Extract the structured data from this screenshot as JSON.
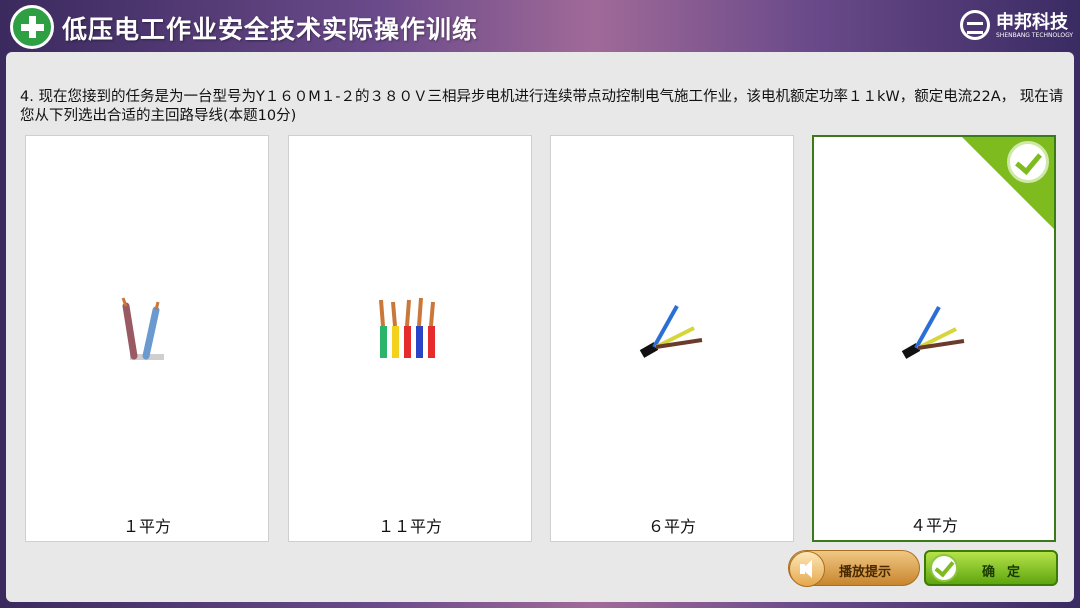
{
  "header": {
    "title": "低压电工作业安全技术实际操作训练",
    "brand_name": "申邦科技",
    "brand_sub": "SHENBANG TECHNOLOGY"
  },
  "question": {
    "text": "4. 现在您接到的任务是为一台型号为Y１６０M１-２的３８０Ｖ三相异步电机进行连续带点动控制电气施工作业，该电机额定功率１１kW，额定电流22A， 现在请您从下列选出合适的主回路导线(本题10分)"
  },
  "options": [
    {
      "label": "１平方",
      "image": "twin-wire-icon",
      "selected": false
    },
    {
      "label": "１１平方",
      "image": "colored-wires-icon",
      "selected": false
    },
    {
      "label": "６平方",
      "image": "three-core-cable-icon",
      "selected": false
    },
    {
      "label": "４平方",
      "image": "three-core-cable-icon",
      "selected": true
    }
  ],
  "buttons": {
    "hint_label": "播放提示",
    "confirm_label": "确定"
  },
  "colors": {
    "accent_green": "#7dbb1f",
    "header_purple": "#6a4a8a",
    "hint_orange": "#e0a24a"
  }
}
